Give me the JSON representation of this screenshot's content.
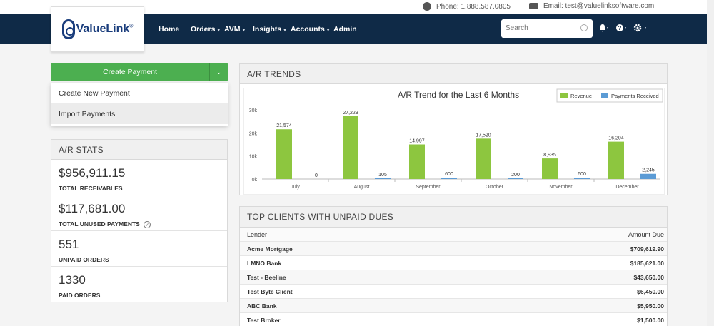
{
  "contact": {
    "phone": "Phone: 1.888.587.0805",
    "email": "Email: test@valuelinksoftware.com"
  },
  "brand": {
    "name": "ValueLink",
    "mark": "®"
  },
  "nav": {
    "items": [
      {
        "label": "Home",
        "dropdown": false
      },
      {
        "label": "Orders",
        "dropdown": true
      },
      {
        "label": "AVM",
        "dropdown": true
      },
      {
        "label": "Insights",
        "dropdown": true
      },
      {
        "label": "Accounts",
        "dropdown": true
      },
      {
        "label": "Admin",
        "dropdown": false
      }
    ],
    "search_placeholder": "Search",
    "caret": "▾"
  },
  "create_payment": {
    "label": "Create Payment",
    "menu": [
      "Create New Payment",
      "Import Payments"
    ]
  },
  "ar_stats": {
    "title": "A/R STATS",
    "items": [
      {
        "value": "$956,911.15",
        "label": "TOTAL RECEIVABLES"
      },
      {
        "value": "$117,681.00",
        "label": "TOTAL UNUSED PAYMENTS",
        "help": "?"
      },
      {
        "value": "551",
        "label": "UNPAID ORDERS"
      },
      {
        "value": "1330",
        "label": "PAID ORDERS"
      }
    ]
  },
  "ar_trends": {
    "title": "A/R TRENDS"
  },
  "chart_data": {
    "type": "bar",
    "title": "A/R Trend for the Last 6 Months",
    "categories": [
      "July",
      "August",
      "September",
      "October",
      "November",
      "December"
    ],
    "series": [
      {
        "name": "Revenue",
        "color": "#8dc63f",
        "values": [
          21574,
          27229,
          14997,
          17520,
          8935,
          16204
        ],
        "labels": [
          "21,574",
          "27,229",
          "14,997",
          "17,520",
          "8,935",
          "16,204"
        ]
      },
      {
        "name": "Payments Received",
        "color": "#5b9bd5",
        "values": [
          0,
          105,
          600,
          200,
          600,
          2245
        ],
        "labels": [
          "0",
          "105",
          "600",
          "200",
          "600",
          "2,245"
        ]
      }
    ],
    "yticks": [
      "0k",
      "10k",
      "20k",
      "30k"
    ],
    "ylim": [
      0,
      30000
    ],
    "legend": "top-right",
    "grid": false
  },
  "top_clients": {
    "title": "TOP CLIENTS WITH UNPAID DUES",
    "columns": [
      "Lender",
      "Amount Due"
    ],
    "rows": [
      {
        "lender": "Acme Mortgage",
        "amount": "$709,619.90"
      },
      {
        "lender": "LMNO Bank",
        "amount": "$185,621.00"
      },
      {
        "lender": "Test - Beeline",
        "amount": "$43,650.00"
      },
      {
        "lender": "Test Byte Client",
        "amount": "$6,450.00"
      },
      {
        "lender": "ABC Bank",
        "amount": "$5,950.00"
      },
      {
        "lender": "Test Broker",
        "amount": "$1,500.00"
      }
    ]
  }
}
